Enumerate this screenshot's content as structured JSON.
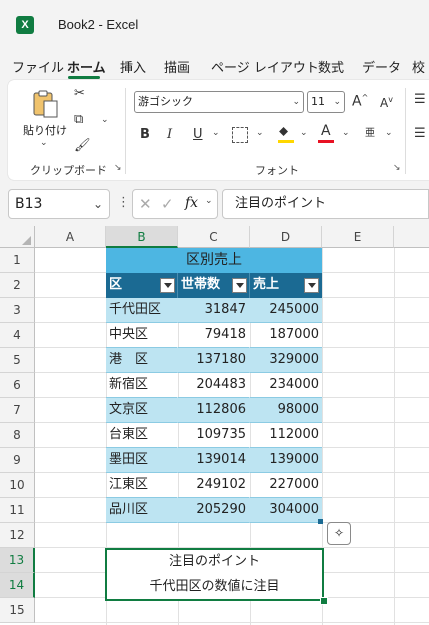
{
  "app": {
    "title": "Book2  -  Excel",
    "icon": "excel-icon"
  },
  "tabs": [
    {
      "label": "ファイル",
      "active": false
    },
    {
      "label": "ホーム",
      "active": true
    },
    {
      "label": "挿入",
      "active": false
    },
    {
      "label": "描画",
      "active": false
    },
    {
      "label": "ページ レイアウト",
      "active": false
    },
    {
      "label": "数式",
      "active": false
    },
    {
      "label": "データ",
      "active": false
    },
    {
      "label": "校",
      "active": false
    }
  ],
  "ribbon": {
    "clipboard": {
      "paste_label": "貼り付け",
      "group_label": "クリップボード"
    },
    "font": {
      "font_name": "游ゴシック",
      "font_size": "11",
      "group_label": "フォント",
      "bold": "B",
      "italic": "I",
      "underline": "U",
      "grow": "A",
      "shrink": "A",
      "font_color_glyph": "A",
      "highlight_color": "#ffd700",
      "font_color": "#e81123"
    }
  },
  "formula_bar": {
    "name_box": "B13",
    "formula": "注目のポイント",
    "fx": "fx"
  },
  "grid": {
    "columns": [
      "A",
      "B",
      "C",
      "D",
      "E"
    ],
    "rows": [
      "1",
      "2",
      "3",
      "4",
      "5",
      "6",
      "7",
      "8",
      "9",
      "10",
      "11",
      "12",
      "13",
      "14",
      "15"
    ],
    "selected_column": "B",
    "table_title": "区別売上",
    "headers": [
      "区",
      "世帯数",
      "売上"
    ],
    "data": [
      [
        "千代田区",
        "31847",
        "245000"
      ],
      [
        "中央区",
        "79418",
        "187000"
      ],
      [
        "港　区",
        "137180",
        "329000"
      ],
      [
        "新宿区",
        "204483",
        "234000"
      ],
      [
        "文京区",
        "112806",
        "98000"
      ],
      [
        "台東区",
        "109735",
        "112000"
      ],
      [
        "墨田区",
        "139014",
        "139000"
      ],
      [
        "江東区",
        "249102",
        "227000"
      ],
      [
        "品川区",
        "205290",
        "304000"
      ]
    ],
    "note_line1": "注目のポイント",
    "note_line2": "千代田区の数値に注目"
  },
  "colors": {
    "accent": "#107c41",
    "table_header": "#1b6a93",
    "band": "#bde4f2",
    "title_fill": "#4db6e2"
  }
}
